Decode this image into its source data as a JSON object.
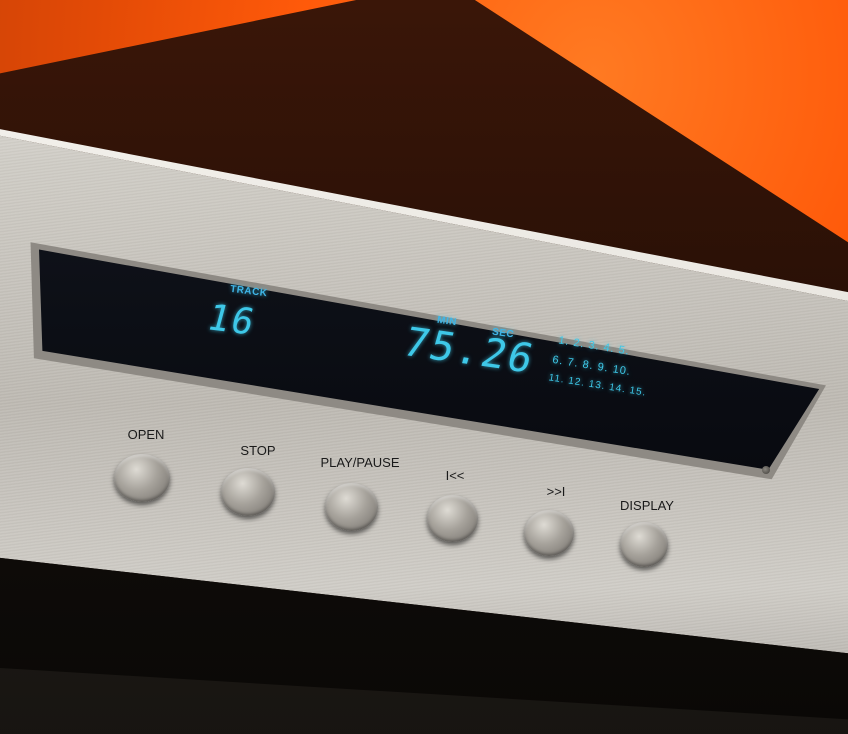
{
  "display": {
    "track_label": "TRACK",
    "track_number": "16",
    "min_label": "MIN",
    "sec_label": "SEC",
    "time": "75.26",
    "track_list": {
      "row1": "1. 2. 3. 4. 5.",
      "row2": "6. 7. 8. 9. 10.",
      "row3": "11. 12. 13. 14. 15."
    }
  },
  "buttons": {
    "open": "OPEN",
    "stop": "STOP",
    "play_pause": "PLAY/PAUSE",
    "prev": "I<<",
    "next": ">>I",
    "display": "DISPLAY"
  },
  "colors": {
    "vfd": "#3ec8e8",
    "wall": "#ff5a0a",
    "faceplate": "#c9c6bf"
  }
}
